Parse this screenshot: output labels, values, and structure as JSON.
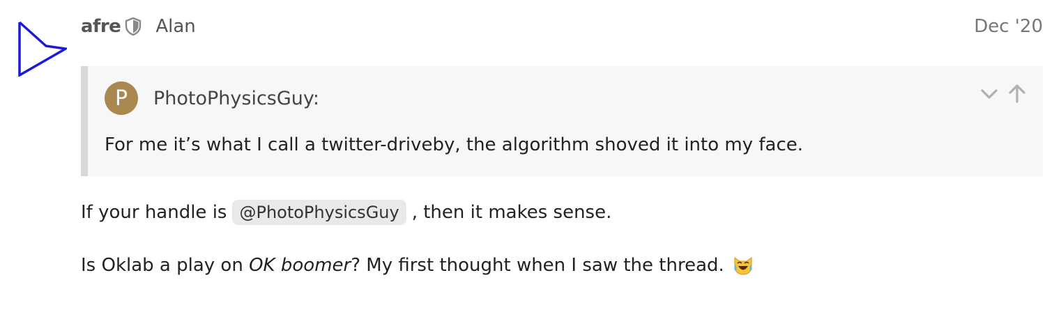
{
  "post": {
    "username": "afre",
    "full_name": "Alan",
    "date": "Dec '20",
    "avatar_icon": "triangle-play-logo-icon",
    "moderator_icon": "shield-icon",
    "accent_color": "#1a1ad6"
  },
  "quote": {
    "username": "PhotoPhysicsGuy:",
    "avatar_letter": "P",
    "avatar_color": "#a9874e",
    "text": "For me it’s what I call a twitter-driveby, the algorithm shoved it into my face.",
    "controls": [
      "chevron-down-icon",
      "arrow-up-icon"
    ]
  },
  "body": {
    "p1_before": "If your handle is",
    "p1_mention": "@PhotoPhysicsGuy",
    "p1_after": ", then it makes sense.",
    "p2_before": "Is Oklab a play on ",
    "p2_italic": "OK boomer",
    "p2_after": "? My first thought when I saw the thread.",
    "p2_emoji": "joy-cat-emoji-icon"
  }
}
